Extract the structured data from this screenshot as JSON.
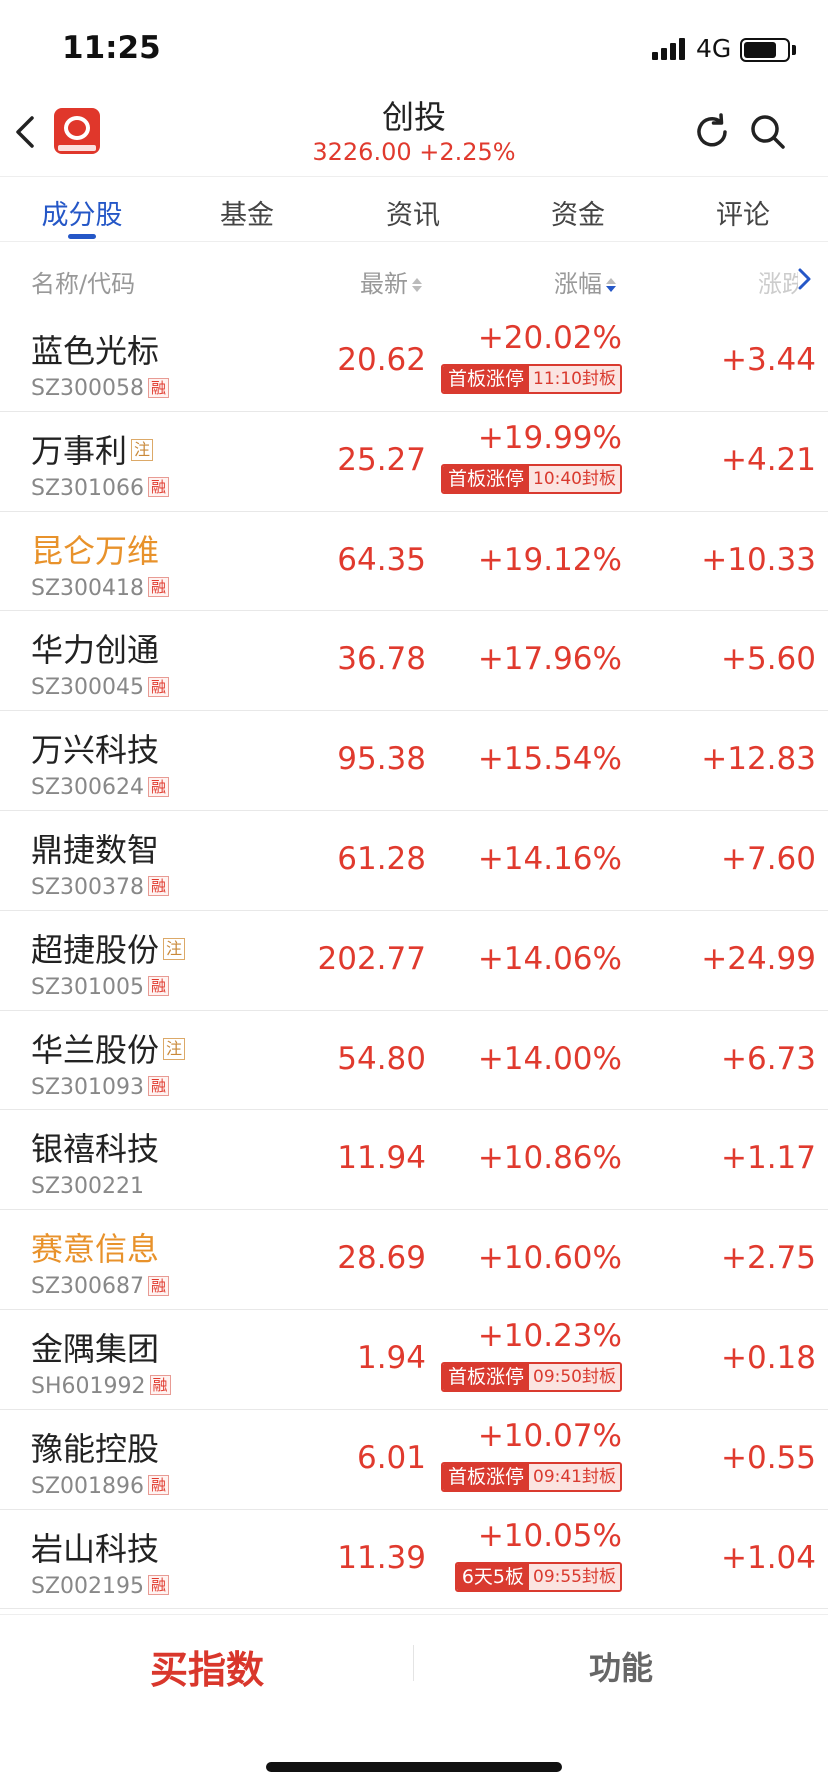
{
  "status_bar": {
    "time": "11:25",
    "network": "4G",
    "battery_level": 0.76
  },
  "header": {
    "title": "创投",
    "subtitle": "3226.00 +2.25%"
  },
  "tabs": [
    {
      "label": "成分股",
      "active": true
    },
    {
      "label": "基金",
      "active": false
    },
    {
      "label": "资讯",
      "active": false
    },
    {
      "label": "资金",
      "active": false
    },
    {
      "label": "评论",
      "active": false
    }
  ],
  "columns": {
    "name": "名称/代码",
    "latest": "最新",
    "change_pct": "涨幅",
    "change_amt": "涨跌"
  },
  "rows": [
    {
      "name": "蓝色光标",
      "code": "SZ300058",
      "rong": "融",
      "price": "20.62",
      "pct": "+20.02%",
      "tag": "首板涨停",
      "tag_time": "11:10封板",
      "chg": "+3.44"
    },
    {
      "name": "万事利",
      "zhu": "注",
      "code": "SZ301066",
      "rong": "融",
      "price": "25.27",
      "pct": "+19.99%",
      "tag": "首板涨停",
      "tag_time": "10:40封板",
      "chg": "+4.21"
    },
    {
      "name": "昆仑万维",
      "highlight": true,
      "code": "SZ300418",
      "rong": "融",
      "price": "64.35",
      "pct": "+19.12%",
      "chg": "+10.33"
    },
    {
      "name": "华力创通",
      "code": "SZ300045",
      "rong": "融",
      "price": "36.78",
      "pct": "+17.96%",
      "chg": "+5.60"
    },
    {
      "name": "万兴科技",
      "code": "SZ300624",
      "rong": "融",
      "price": "95.38",
      "pct": "+15.54%",
      "chg": "+12.83"
    },
    {
      "name": "鼎捷数智",
      "code": "SZ300378",
      "rong": "融",
      "price": "61.28",
      "pct": "+14.16%",
      "chg": "+7.60"
    },
    {
      "name": "超捷股份",
      "zhu": "注",
      "code": "SZ301005",
      "rong": "融",
      "price": "202.77",
      "pct": "+14.06%",
      "chg": "+24.99"
    },
    {
      "name": "华兰股份",
      "zhu": "注",
      "code": "SZ301093",
      "rong": "融",
      "price": "54.80",
      "pct": "+14.00%",
      "chg": "+6.73"
    },
    {
      "name": "银禧科技",
      "code": "SZ300221",
      "price": "11.94",
      "pct": "+10.86%",
      "chg": "+1.17"
    },
    {
      "name": "赛意信息",
      "highlight": true,
      "code": "SZ300687",
      "rong": "融",
      "price": "28.69",
      "pct": "+10.60%",
      "chg": "+2.75"
    },
    {
      "name": "金隅集团",
      "code": "SH601992",
      "rong": "融",
      "price": "1.94",
      "pct": "+10.23%",
      "tag": "首板涨停",
      "tag_time": "09:50封板",
      "chg": "+0.18"
    },
    {
      "name": "豫能控股",
      "code": "SZ001896",
      "rong": "融",
      "price": "6.01",
      "pct": "+10.07%",
      "tag": "首板涨停",
      "tag_time": "09:41封板",
      "chg": "+0.55"
    },
    {
      "name": "岩山科技",
      "code": "SZ002195",
      "rong": "融",
      "price": "11.39",
      "pct": "+10.05%",
      "tag": "6天5板",
      "tag_time": "09:55封板",
      "chg": "+1.04"
    }
  ],
  "bottom_bar": {
    "buy_label": "买指数",
    "function_label": "功能"
  },
  "colors": {
    "up": "#e03a2e",
    "accent": "#2557c7",
    "highlight_name": "#e8922b",
    "tag": "#d93a2f"
  },
  "icons": [
    "back-icon",
    "app-logo",
    "refresh-icon",
    "search-icon",
    "sort-icon",
    "chevron-right-icon"
  ]
}
